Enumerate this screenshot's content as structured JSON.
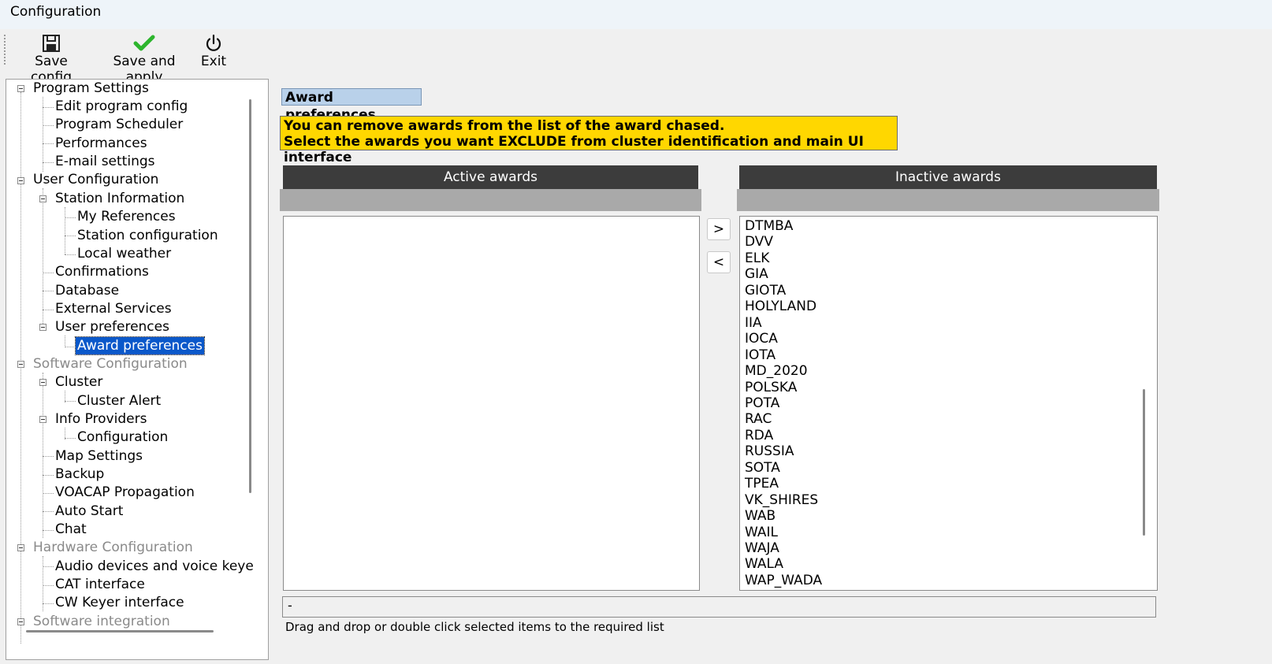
{
  "window": {
    "title": "Configuration"
  },
  "toolbar": {
    "save_config": "Save config",
    "save_apply": "Save and apply",
    "exit": "Exit",
    "icons": {
      "save": "floppy-icon",
      "apply": "check-icon",
      "exit": "power-icon"
    }
  },
  "tree": {
    "items": [
      "Program Settings",
      "Edit program config",
      "Program Scheduler",
      "Performances",
      "E-mail settings",
      "User Configuration",
      "Station Information",
      "My References",
      "Station configuration",
      "Local weather",
      "Confirmations",
      "Database",
      "External Services",
      "User preferences",
      "Award preferences",
      "Software Configuration",
      "Cluster",
      "Cluster Alert",
      "Info Providers",
      "Configuration",
      "Map Settings",
      "Backup",
      "VOACAP Propagation",
      "Auto Start",
      "Chat",
      "Hardware Configuration",
      "Audio devices and voice keye",
      "CAT interface",
      "CW Keyer interface",
      "Software integration"
    ],
    "selected": "Award preferences"
  },
  "main": {
    "section_title": "Award preferences",
    "info_line1": "You can remove awards from the list of the award chased.",
    "info_line2": "Select the awards you want EXCLUDE from cluster identification and main UI interface",
    "active_header": "Active awards",
    "inactive_header": "Inactive awards",
    "move_right": ">",
    "move_left": "<",
    "active_awards": [],
    "inactive_awards": [
      "DTMBA",
      "DVV",
      "ELK",
      "GIA",
      "GIOTA",
      "HOLYLAND",
      "IIA",
      "IOCA",
      "IOTA",
      "MD_2020",
      "POLSKA",
      "POTA",
      "RAC",
      "RDA",
      "RUSSIA",
      "SOTA",
      "TPEA",
      "VK_SHIRES",
      "WAB",
      "WAIL",
      "WAJA",
      "WALA",
      "WAP_WADA"
    ],
    "status_text": "-",
    "hint": "Drag and drop or double click selected items to the required list"
  },
  "colors": {
    "section_title_bg": "#b9d1ea",
    "info_bg": "#ffd700",
    "header_bg": "#3c3c3c",
    "subheader_bg": "#a9a9a9",
    "selection": "#0a58ca"
  }
}
